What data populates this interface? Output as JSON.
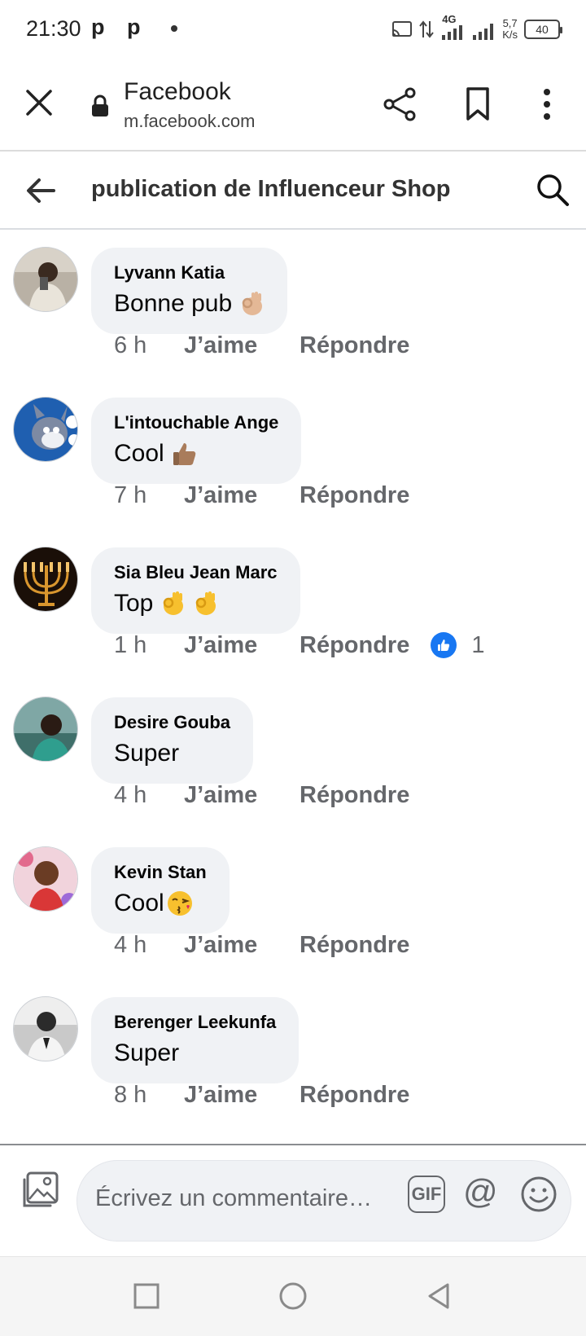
{
  "status_bar": {
    "time": "21:30",
    "notification_icons": [
      "p",
      "p"
    ],
    "network_type": "4G",
    "speed_value": "5,7",
    "speed_unit": "K/s",
    "battery": "40"
  },
  "browser": {
    "page_title": "Facebook",
    "url": "m.facebook.com",
    "icons": [
      "close-icon",
      "lock-icon",
      "share-icon",
      "bookmark-icon",
      "more-vertical-icon"
    ]
  },
  "header": {
    "title": "publication de Influenceur Shop"
  },
  "comments": [
    {
      "name": "Lyvann Katia",
      "text": "Bonne pub",
      "emojis": [
        "ok-hand-emoji"
      ],
      "time": "6 h",
      "like_label": "J’aime",
      "reply_label": "Répondre"
    },
    {
      "name": "L'intouchable Ange",
      "text": "Cool",
      "emojis": [
        "thumbs-up-emoji"
      ],
      "time": "7 h",
      "like_label": "J’aime",
      "reply_label": "Répondre"
    },
    {
      "name": "Sia Bleu Jean Marc",
      "text": "Top",
      "emojis": [
        "ok-hand-emoji",
        "ok-hand-emoji"
      ],
      "time": "1 h",
      "like_label": "J’aime",
      "reply_label": "Répondre",
      "reaction_count": "1"
    },
    {
      "name": "Desire Gouba",
      "text": "Super",
      "emojis": [],
      "time": "4 h",
      "like_label": "J’aime",
      "reply_label": "Répondre"
    },
    {
      "name": "Kevin Stan",
      "text": "Cool",
      "emojis": [
        "kiss-emoji"
      ],
      "time": "4 h",
      "like_label": "J’aime",
      "reply_label": "Répondre"
    },
    {
      "name": "Berenger Leekunfa",
      "text": "Super",
      "emojis": [],
      "time": "8 h",
      "like_label": "J’aime",
      "reply_label": "Répondre"
    }
  ],
  "composer": {
    "placeholder": "Écrivez un commentaire…",
    "gif_label": "GIF",
    "mention_symbol": "@"
  },
  "colors": {
    "bubble_bg": "#f0f2f5",
    "meta_text": "#65676b",
    "like_blue": "#1877f2"
  }
}
